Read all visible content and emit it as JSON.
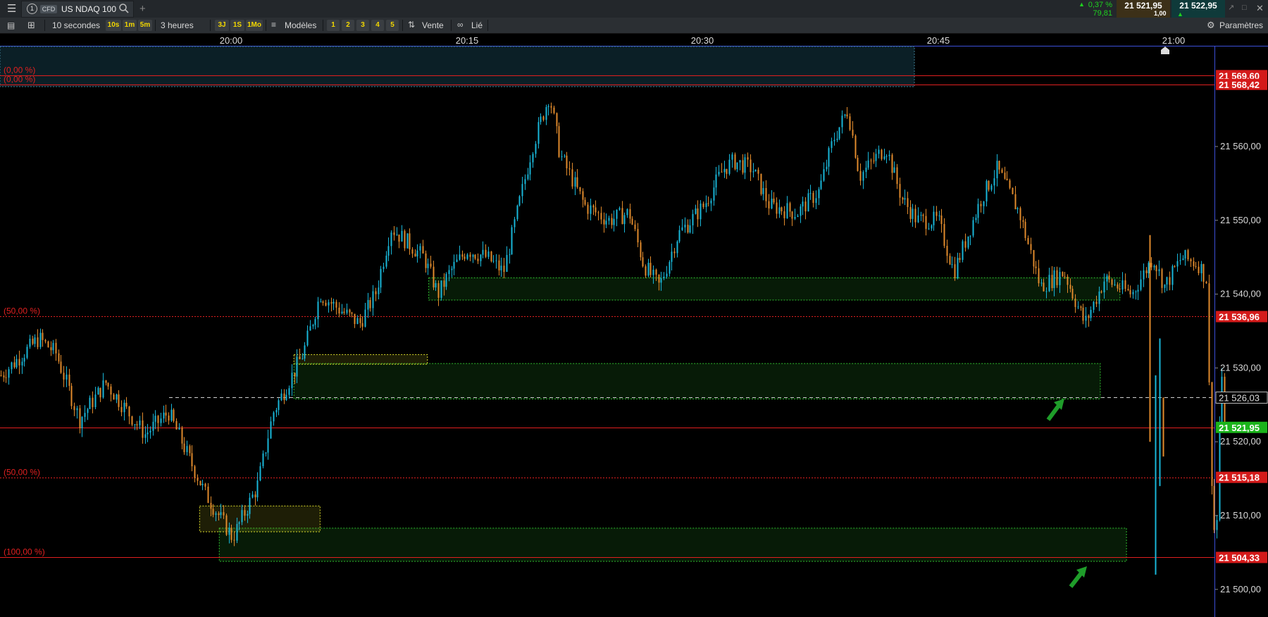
{
  "toolbar": {
    "tab_index": "1",
    "tab_badge": "CFD",
    "instrument": "US NDAQ 100",
    "add_label": "+",
    "change_pct": "0,37 %",
    "change_abs": "79,81",
    "bid": "21 521,95",
    "ask": "21 522,95",
    "size": "1,00"
  },
  "toolbar2": {
    "interval": "10 secondes",
    "quick_intervals": [
      "10s",
      "1m",
      "5m"
    ],
    "range": "3 heures",
    "quick_ranges": [
      "3J",
      "1S",
      "1Mo"
    ],
    "templates_label": "Modèles",
    "template_slots": [
      "1",
      "2",
      "3",
      "4",
      "5"
    ],
    "sell_label": "Vente",
    "linked_label": "Lié",
    "settings_label": "Paramètres"
  },
  "time_axis": [
    "20:00",
    "20:15",
    "20:30",
    "20:45",
    "21:00"
  ],
  "colors": {
    "up": "#19b6d8",
    "down": "#e08a2c",
    "level_red": "#e01f1f",
    "zone_green": "#2fbf2f",
    "zone_yellow": "#d8d82a",
    "price_green": "#1bb51b",
    "arrow_green": "#1f9d2a"
  },
  "chart_data": {
    "type": "candlestick",
    "instrument": "US NDAQ 100",
    "interval": "10 secondes",
    "x_ticks": [
      "20:00",
      "20:15",
      "20:30",
      "20:45",
      "21:00"
    ],
    "y_ticks": [
      21560,
      21550,
      21540,
      21530,
      21520,
      21510,
      21500
    ],
    "y_tick_labels": [
      "21 560,00",
      "21 550,00",
      "21 540,00",
      "21 530,00",
      "21 520,00",
      "21 510,00",
      "21 500,00"
    ],
    "ylim": [
      21496,
      21571
    ],
    "levels": [
      {
        "price": 21569.6,
        "label": "21 569,60",
        "tag": "(0,00 %)",
        "style": "solid"
      },
      {
        "price": 21568.42,
        "label": "21 568,42",
        "tag": "(0,00 %)",
        "style": "solid"
      },
      {
        "price": 21536.96,
        "label": "21 536,96",
        "tag": "(50,00 %)",
        "style": "dotted"
      },
      {
        "price": 21521.95,
        "label": "21 521,95",
        "tag": "",
        "style": "solid",
        "current": true
      },
      {
        "price": 21515.18,
        "label": "21 515,18",
        "tag": "(50,00 %)",
        "style": "dotted"
      },
      {
        "price": 21504.33,
        "label": "21 504,33",
        "tag": "(100,00 %)",
        "style": "solid"
      }
    ],
    "crosshair": {
      "price": 21526.03,
      "label": "21 526,03"
    },
    "zones": [
      {
        "type": "green",
        "t_start": "20:12:35",
        "t_end": "20:56:35",
        "p_low": 21539.2,
        "p_high": 21542.2
      },
      {
        "type": "green",
        "t_start": "20:04:00",
        "t_end": "20:55:20",
        "p_low": 21525.8,
        "p_high": 21530.6
      },
      {
        "type": "yellow",
        "t_start": "20:04:00",
        "t_end": "20:12:30",
        "p_low": 21530.5,
        "p_high": 21531.8
      },
      {
        "type": "green",
        "t_start": "19:59:15",
        "t_end": "20:57:00",
        "p_low": 21503.8,
        "p_high": 21508.3
      },
      {
        "type": "yellow",
        "t_start": "19:58:00",
        "t_end": "20:05:40",
        "p_low": 21507.8,
        "p_high": 21511.3
      }
    ],
    "keypoints": [
      [
        "19:45:20",
        21529
      ],
      [
        "19:47:45",
        21534
      ],
      [
        "19:48:50",
        21532
      ],
      [
        "19:50:20",
        21523
      ],
      [
        "19:52:00",
        21528
      ],
      [
        "19:54:30",
        21521
      ],
      [
        "19:56:00",
        21524
      ],
      [
        "19:58:20",
        21513
      ],
      [
        "20:00:05",
        21507
      ],
      [
        "20:01:40",
        21514
      ],
      [
        "20:02:40",
        21524
      ],
      [
        "20:04:35",
        21532
      ],
      [
        "20:05:40",
        21540
      ],
      [
        "20:06:50",
        21538
      ],
      [
        "20:08:10",
        21536
      ],
      [
        "20:09:10",
        21540
      ],
      [
        "20:10:10",
        21549
      ],
      [
        "20:12:15",
        21545
      ],
      [
        "20:13:10",
        21540
      ],
      [
        "20:13:55",
        21543
      ],
      [
        "20:15:00",
        21546
      ],
      [
        "20:16:15",
        21545
      ],
      [
        "20:17:20",
        21543
      ],
      [
        "20:19:10",
        21560
      ],
      [
        "20:20:15",
        21567
      ],
      [
        "20:20:55",
        21559
      ],
      [
        "20:22:30",
        21552
      ],
      [
        "20:24:00",
        21550
      ],
      [
        "20:25:20",
        21551
      ],
      [
        "20:26:15",
        21544
      ],
      [
        "20:27:15",
        21541
      ],
      [
        "20:28:25",
        21548
      ],
      [
        "20:30:05",
        21552
      ],
      [
        "20:31:20",
        21557
      ],
      [
        "20:32:00",
        21558
      ],
      [
        "20:33:10",
        21557
      ],
      [
        "20:34:15",
        21552
      ],
      [
        "20:36:00",
        21551
      ],
      [
        "20:37:25",
        21554
      ],
      [
        "20:38:20",
        21561
      ],
      [
        "20:39:15",
        21565
      ],
      [
        "20:40:00",
        21556
      ],
      [
        "20:41:40",
        21560
      ],
      [
        "20:42:40",
        21553
      ],
      [
        "20:43:40",
        21550
      ],
      [
        "20:45:00",
        21550
      ],
      [
        "20:46:00",
        21543
      ],
      [
        "20:47:45",
        21553
      ],
      [
        "20:48:45",
        21557
      ],
      [
        "20:50:10",
        21551
      ],
      [
        "20:51:30",
        21541
      ],
      [
        "20:53:00",
        21543
      ],
      [
        "20:54:20",
        21536
      ],
      [
        "20:55:35",
        21542
      ],
      [
        "20:57:20",
        21540
      ],
      [
        "20:58:40",
        21545
      ],
      [
        "20:59:25",
        21541
      ],
      [
        "21:00:30",
        21545
      ],
      [
        "21:01:35",
        21544
      ],
      [
        "21:02:05",
        21542
      ],
      [
        "21:02:20",
        21518
      ],
      [
        "21:02:40",
        21504
      ],
      [
        "21:03:00",
        21530
      ],
      [
        "21:03:15",
        21522
      ]
    ],
    "grid": false,
    "price_axis": "right"
  }
}
